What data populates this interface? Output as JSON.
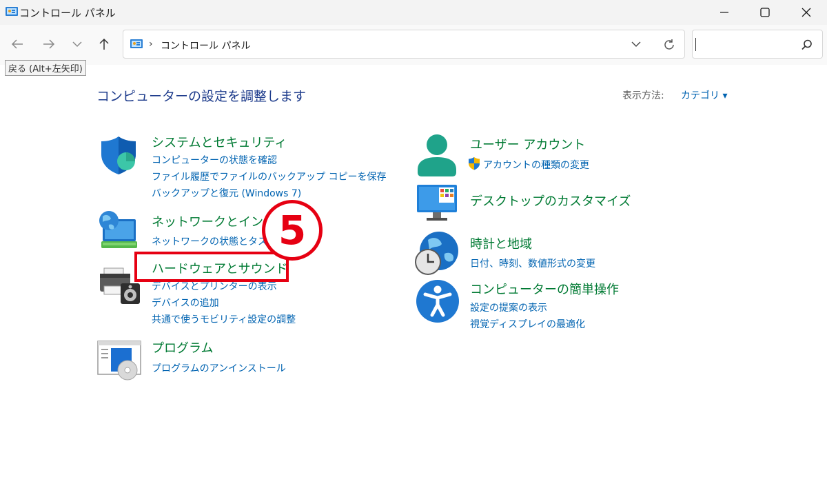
{
  "window": {
    "title": "コントロール パネル",
    "controls": {
      "minimize": "—",
      "maximize": "☐",
      "close": "✕"
    }
  },
  "nav": {
    "back_icon": "arrow-left-icon",
    "forward_icon": "arrow-right-icon",
    "recent_icon": "chevron-down-icon",
    "up_icon": "arrow-up-icon",
    "tooltip": "戻る (Alt+左矢印)"
  },
  "address": {
    "separator": "›",
    "location": "コントロール パネル"
  },
  "search": {
    "value": "",
    "placeholder": ""
  },
  "page": {
    "title": "コンピューターの設定を調整します",
    "view_by_label": "表示方法:",
    "view_by_value": "カテゴリ ▾"
  },
  "categories": {
    "system_security": {
      "title": "システムとセキュリティ",
      "links": [
        "コンピューターの状態を確認",
        "ファイル履歴でファイルのバックアップ コピーを保存",
        "バックアップと復元 (Windows 7)"
      ]
    },
    "network": {
      "title": "ネットワークとインター",
      "links": [
        "ネットワークの状態とタスク"
      ]
    },
    "hardware": {
      "title": "ハードウェアとサウンド",
      "links": [
        "デバイスとプリンターの表示",
        "デバイスの追加",
        "共通で使うモビリティ設定の調整"
      ]
    },
    "programs": {
      "title": "プログラム",
      "links": [
        "プログラムのアンインストール"
      ]
    },
    "user_accounts": {
      "title": "ユーザー アカウント",
      "links": [
        "アカウントの種類の変更"
      ]
    },
    "appearance": {
      "title": "デスクトップのカスタマイズ"
    },
    "clock_region": {
      "title": "時計と地域",
      "links": [
        "日付、時刻、数値形式の変更"
      ]
    },
    "ease_of_access": {
      "title": "コンピューターの簡単操作",
      "links": [
        "設定の提案の表示",
        "視覚ディスプレイの最適化"
      ]
    }
  },
  "annotation": {
    "step_number": "5",
    "color": "#e60012"
  },
  "colors": {
    "category_title": "#007a33",
    "link": "#0063b1",
    "page_title": "#1e3c8c"
  }
}
